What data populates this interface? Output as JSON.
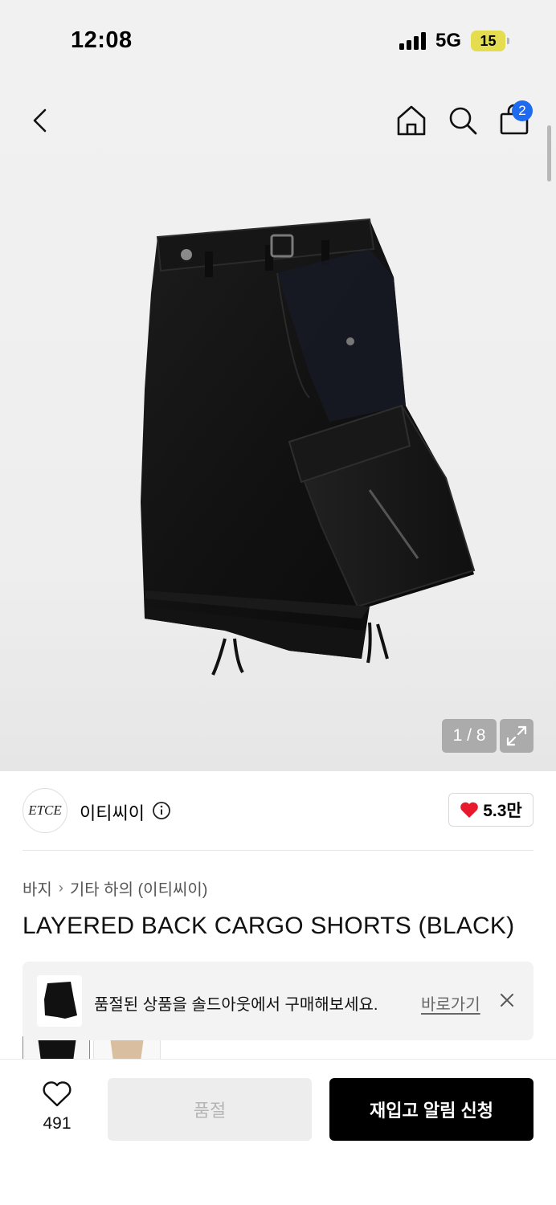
{
  "status_bar": {
    "time": "12:08",
    "network": "5G",
    "battery": "15",
    "signal_icon": "signal-bars-icon"
  },
  "header": {
    "back_icon": "chevron-left-icon",
    "home_icon": "home-icon",
    "search_icon": "search-icon",
    "cart_icon": "shopping-bag-icon",
    "cart_count": "2"
  },
  "gallery": {
    "counter": "1 / 8",
    "expand_icon": "expand-icon"
  },
  "brand": {
    "logo_text": "ETCE",
    "name": "이티씨이",
    "info_icon": "info-icon",
    "likes": "5.3만",
    "heart_color": "#e8192c"
  },
  "breadcrumb": {
    "items": [
      "바지",
      "기타 하의 (이티씨이)"
    ],
    "separator": "›"
  },
  "product": {
    "title": "LAYERED BACK CARGO SHORTS (BLACK)"
  },
  "soldout_banner": {
    "message": "품절된 상품을 솔드아웃에서 구매해보세요.",
    "link_label": "바로가기",
    "close_icon": "close-icon"
  },
  "bottom_bar": {
    "wish_count": "491",
    "wish_icon": "heart-outline-icon",
    "soldout_label": "품절",
    "restock_label": "재입고 알림 신청"
  }
}
